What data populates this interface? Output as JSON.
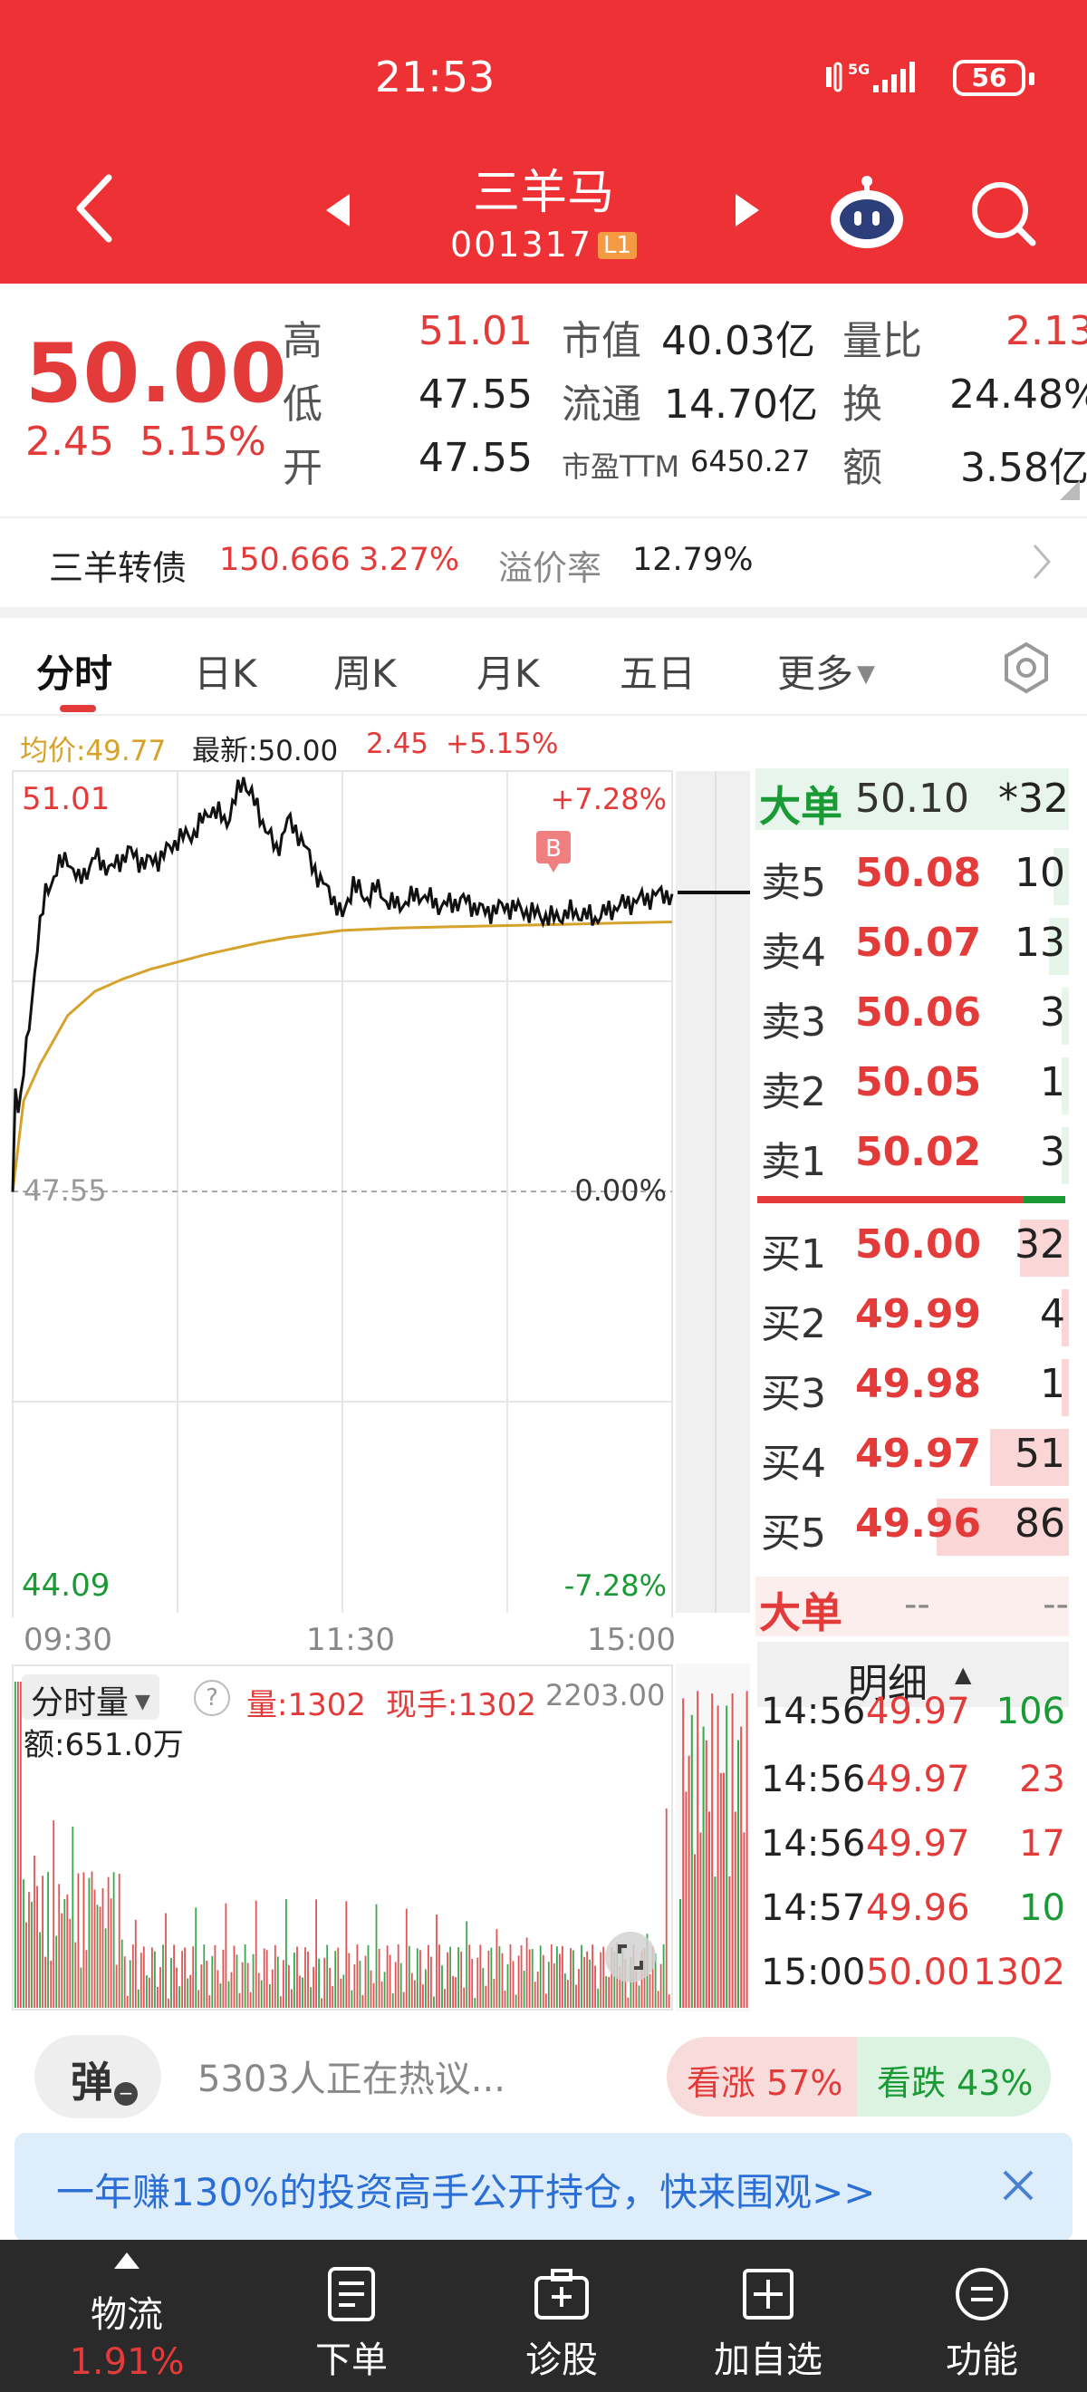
{
  "status_bar": {
    "time": "21:53",
    "network": "5G",
    "battery": "56"
  },
  "header": {
    "title": "三羊马",
    "code": "001317",
    "badge": "L1"
  },
  "quote": {
    "price": "50.00",
    "change": "2.45",
    "change_pct": "5.15%",
    "high_label": "高",
    "high": "51.01",
    "low_label": "低",
    "low": "47.55",
    "open_label": "开",
    "open": "47.55",
    "mktcap_label": "市值",
    "mktcap": "40.03亿",
    "float_label": "流通",
    "float": "14.70亿",
    "pe_label": "市盈TTM",
    "pe": "6450.27",
    "vol_ratio_label": "量比",
    "vol_ratio": "2.13",
    "turnover_label": "换",
    "turnover": "24.48%",
    "amount_label": "额",
    "amount": "3.58亿"
  },
  "bond": {
    "name": "三羊转债",
    "price": "150.666",
    "pct": "3.27%",
    "premium_label": "溢价率",
    "premium": "12.79%"
  },
  "tabs": [
    "分时",
    "日K",
    "周K",
    "月K",
    "五日",
    "更多"
  ],
  "chart_info": {
    "avg": "均价:49.77",
    "latest": "最新:50.00",
    "change": "2.45",
    "pct": "+5.15%"
  },
  "chart_labels": {
    "y_top": "51.01",
    "y_mid": "47.55",
    "y_bottom": "44.09",
    "pct_top": "+7.28%",
    "pct_mid": "0.00%",
    "pct_bottom": "-7.28%",
    "times": [
      "09:30",
      "11:30",
      "15:00"
    ],
    "marker": "B"
  },
  "volume_panel": {
    "selector": "分时量",
    "help": "?",
    "vol": "量:1302",
    "hand": "现手:1302",
    "max": "2203.00",
    "amount": "额:651.0万"
  },
  "chart_data": {
    "type": "line",
    "title": "",
    "xlabel": "",
    "ylabel": "",
    "ylim": [
      44.09,
      51.01
    ],
    "x_ticks": [
      "09:30",
      "11:30",
      "15:00"
    ],
    "prev_close": 47.55,
    "series": [
      {
        "name": "",
        "color": "#111111",
        "x": [
          0,
          1,
          2,
          4,
          6,
          9,
          12,
          16,
          20,
          24,
          30,
          36,
          42,
          48,
          54,
          60,
          66,
          72,
          78,
          84,
          90,
          96,
          100,
          104,
          108,
          112,
          116,
          120,
          124,
          128,
          132,
          136,
          140,
          148,
          156,
          164,
          172,
          180,
          188,
          196,
          204,
          212,
          220,
          228,
          236,
          240
        ],
        "values": [
          47.55,
          48.4,
          48.2,
          48.55,
          48.9,
          49.6,
          50.0,
          50.2,
          50.3,
          50.1,
          50.3,
          50.2,
          50.35,
          50.25,
          50.3,
          50.45,
          50.5,
          50.7,
          50.6,
          50.95,
          50.65,
          50.35,
          50.6,
          50.5,
          50.3,
          50.1,
          50.0,
          49.8,
          50.1,
          49.95,
          50.05,
          49.95,
          49.9,
          50.0,
          49.9,
          49.95,
          49.85,
          49.9,
          49.85,
          49.8,
          49.85,
          49.8,
          49.9,
          49.95,
          50.0,
          50.0
        ]
      },
      {
        "name": "",
        "color": "#d6a22b",
        "x": [
          0,
          4,
          10,
          20,
          30,
          40,
          50,
          60,
          70,
          80,
          90,
          100,
          110,
          120,
          140,
          160,
          180,
          200,
          220,
          240
        ],
        "values": [
          47.55,
          48.3,
          48.6,
          49.0,
          49.2,
          49.3,
          49.38,
          49.44,
          49.5,
          49.55,
          49.6,
          49.64,
          49.67,
          49.7,
          49.72,
          49.73,
          49.74,
          49.75,
          49.76,
          49.77
        ]
      }
    ]
  },
  "order_book": {
    "big_label": "大单",
    "big_price": "50.10",
    "big_vol": "*32",
    "asks": [
      {
        "label": "卖5",
        "price": "50.08",
        "vol": "10"
      },
      {
        "label": "卖4",
        "price": "50.07",
        "vol": "13"
      },
      {
        "label": "卖3",
        "price": "50.06",
        "vol": "3"
      },
      {
        "label": "卖2",
        "price": "50.05",
        "vol": "1"
      },
      {
        "label": "卖1",
        "price": "50.02",
        "vol": "3"
      }
    ],
    "bids": [
      {
        "label": "买1",
        "price": "50.00",
        "vol": "32"
      },
      {
        "label": "买2",
        "price": "49.99",
        "vol": "4"
      },
      {
        "label": "买3",
        "price": "49.98",
        "vol": "1"
      },
      {
        "label": "买4",
        "price": "49.97",
        "vol": "51"
      },
      {
        "label": "买5",
        "price": "49.96",
        "vol": "86"
      }
    ],
    "big2_label": "大单",
    "big2_price": "--",
    "big2_vol": "--",
    "detail_label": "明细"
  },
  "ticks": [
    {
      "time": "14:56",
      "price": "49.97",
      "vol": "106"
    },
    {
      "time": "14:56",
      "price": "49.97",
      "vol": "23"
    },
    {
      "time": "14:56",
      "price": "49.97",
      "vol": "17"
    },
    {
      "time": "14:57",
      "price": "49.96",
      "vol": "10"
    },
    {
      "time": "15:00",
      "price": "50.00",
      "vol": "1302"
    }
  ],
  "hot": {
    "danmu": "弹",
    "text": "5303人正在热议...",
    "bull": "看涨 57%",
    "bear": "看跌 43%"
  },
  "banner": {
    "text": "一年赚130%的投资高手公开持仓，快来围观>>"
  },
  "nav": {
    "items": [
      {
        "label": "物流",
        "sub": "1.91%",
        "icon": "caret-up-icon"
      },
      {
        "label": "下单",
        "icon": "document-icon"
      },
      {
        "label": "诊股",
        "icon": "briefcase-plus-icon"
      },
      {
        "label": "加自选",
        "icon": "plus-box-icon"
      },
      {
        "label": "功能",
        "icon": "menu-circle-icon"
      }
    ]
  }
}
